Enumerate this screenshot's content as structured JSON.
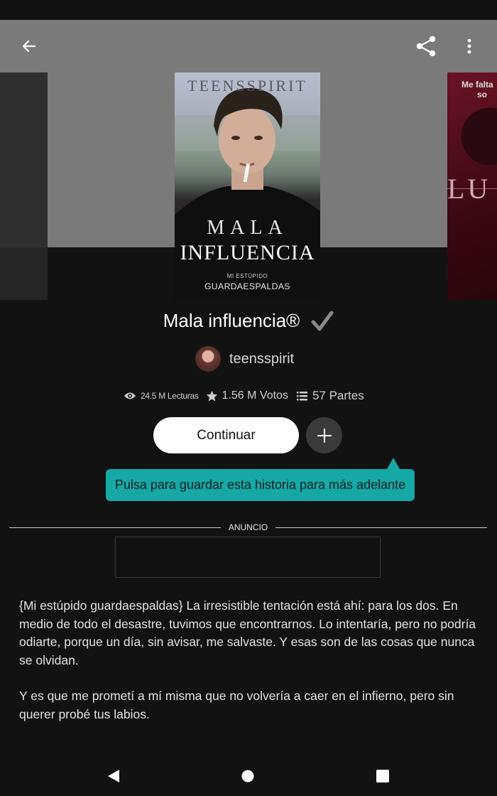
{
  "app_bar": {
    "back_icon": "arrow-left-icon",
    "share_icon": "share-icon",
    "more_icon": "more-vertical-icon"
  },
  "cover": {
    "brand": "TEENSSPIRIT",
    "title_line1": "MALA",
    "title_line2": "INFLUENCIA",
    "subtitle_line1": "MI ESTÚPIDO",
    "subtitle_line2": "GUARDAESPALDAS"
  },
  "next_cover": {
    "text_line1": "Me falta",
    "text_line2": "so",
    "letters": "LU"
  },
  "story": {
    "title": "Mala influencia®",
    "completed_icon": "checkmark-icon",
    "author": "teensspirit"
  },
  "stats": {
    "reads": "24.5 M Lecturas",
    "votes": "1.56 M Votos",
    "parts": "57 Partes"
  },
  "actions": {
    "continue_label": "Continuar",
    "add_icon": "plus-icon"
  },
  "tooltip": {
    "text": "Pulsa para guardar esta historia para más adelante"
  },
  "ad": {
    "label": "ANUNCIO"
  },
  "description": {
    "paragraph1": "{Mi estúpido guardaespaldas} La irresistible tentación está ahí: para los dos. En medio de todo el desastre, tuvimos que encontrarnos. Lo intentaría, pero no podría odiarte, porque un día, sin avisar, me salvaste. Y esas son de las cosas que nunca se olvidan.",
    "paragraph2": "Y es que me prometí a mí misma que no volvería a caer en el infierno, pero sin querer probé tus labios."
  },
  "colors": {
    "background": "#121212",
    "header": "#7a7a7a",
    "accent_tooltip": "#16a8a5",
    "button_bg": "#ffffff"
  }
}
